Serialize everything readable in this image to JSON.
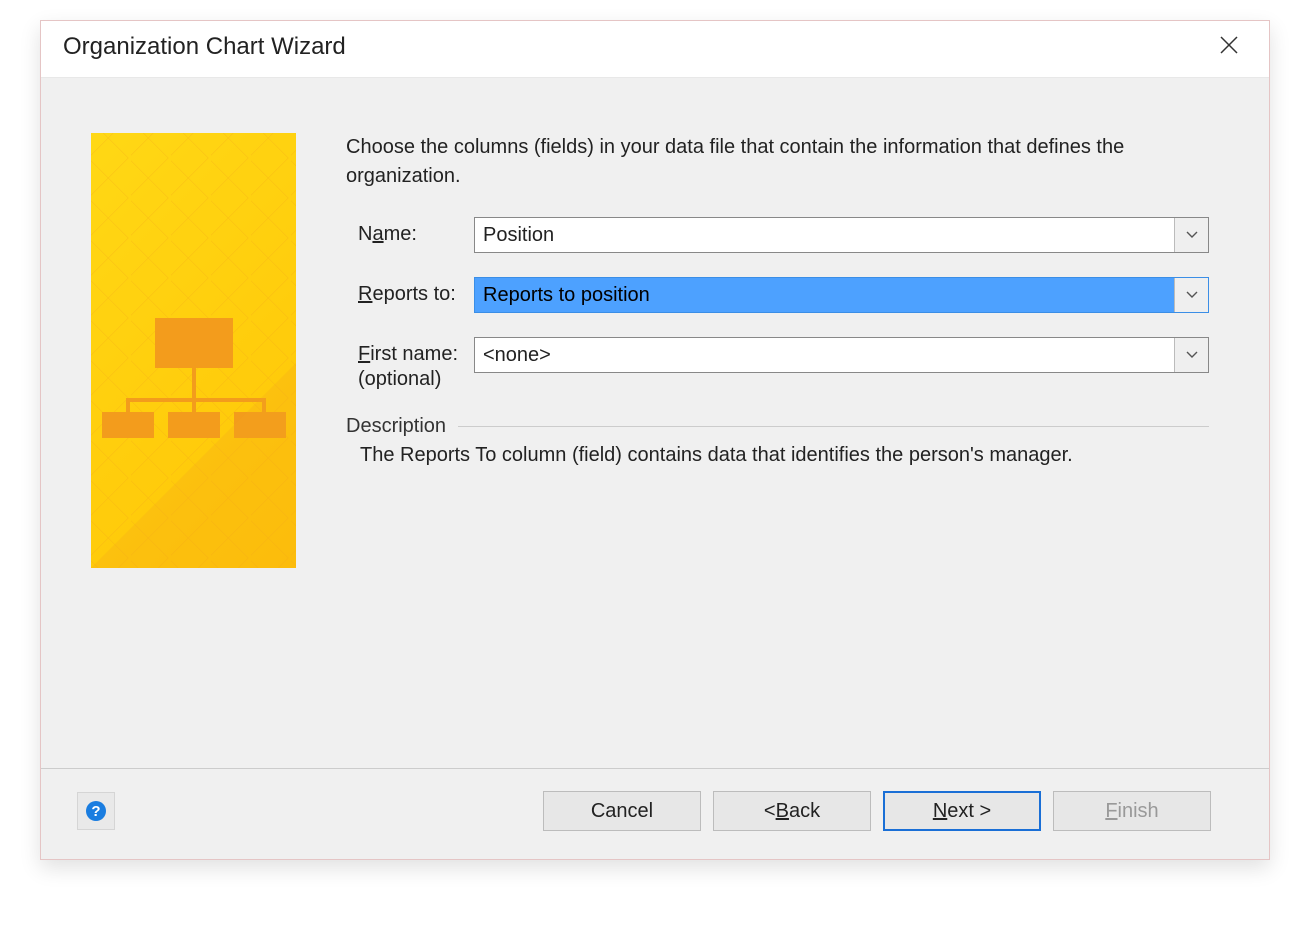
{
  "dialog": {
    "title": "Organization Chart Wizard"
  },
  "intro": "Choose the columns (fields) in your data file that contain the information that defines the organization.",
  "fields": {
    "name": {
      "label_prefix": "N",
      "label_underlined": "a",
      "label_suffix": "me:",
      "value": "Position"
    },
    "reports_to": {
      "label_underlined": "R",
      "label_suffix": "eports to:",
      "value": "Reports to position"
    },
    "first_name": {
      "label_underlined": "F",
      "label_suffix": "irst name:",
      "optional": "(optional)",
      "value": "<none>"
    }
  },
  "description": {
    "title": "Description",
    "text": "The Reports To column (field) contains data that identifies the person's manager."
  },
  "buttons": {
    "cancel": "Cancel",
    "back_prefix": "< ",
    "back_underlined": "B",
    "back_suffix": "ack",
    "next_underlined": "N",
    "next_suffix": "ext >",
    "finish_underlined": "F",
    "finish_suffix": "inish"
  }
}
